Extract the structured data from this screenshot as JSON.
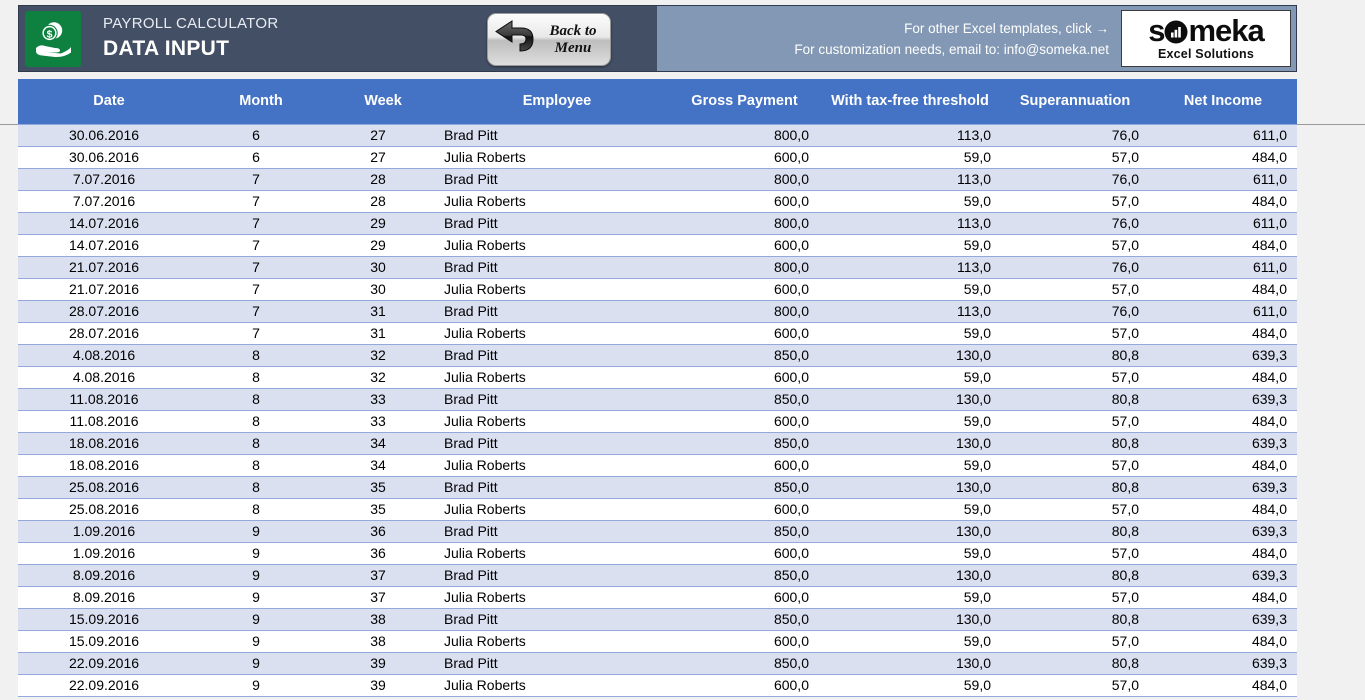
{
  "banner": {
    "logo_icon": "money-in-hand-icon",
    "subtitle": "PAYROLL CALCULATOR",
    "title": "DATA INPUT",
    "back_button": {
      "line1": "Back to",
      "line2": "Menu",
      "icon": "back-arrow-icon"
    },
    "promo_line1": "For other Excel templates, click →",
    "promo_line2": "For customization needs, email to: info@someka.net",
    "brand": {
      "word": "someka",
      "tagline": "Excel Solutions"
    },
    "colors": {
      "dark_panel": "#434f65",
      "light_panel": "#8298b4",
      "logo_green": "#0e8140",
      "table_header_blue": "#4472c4",
      "row_stripe_blue": "#dbe0f1"
    }
  },
  "table": {
    "columns": [
      "Date",
      "Month",
      "Week",
      "Employee",
      "Gross Payment",
      "With tax-free threshold",
      "Superannuation",
      "Net Income"
    ],
    "rows": [
      [
        "30.06.2016",
        "6",
        "27",
        "Brad Pitt",
        "800,0",
        "113,0",
        "76,0",
        "611,0"
      ],
      [
        "30.06.2016",
        "6",
        "27",
        "Julia Roberts",
        "600,0",
        "59,0",
        "57,0",
        "484,0"
      ],
      [
        "7.07.2016",
        "7",
        "28",
        "Brad Pitt",
        "800,0",
        "113,0",
        "76,0",
        "611,0"
      ],
      [
        "7.07.2016",
        "7",
        "28",
        "Julia Roberts",
        "600,0",
        "59,0",
        "57,0",
        "484,0"
      ],
      [
        "14.07.2016",
        "7",
        "29",
        "Brad Pitt",
        "800,0",
        "113,0",
        "76,0",
        "611,0"
      ],
      [
        "14.07.2016",
        "7",
        "29",
        "Julia Roberts",
        "600,0",
        "59,0",
        "57,0",
        "484,0"
      ],
      [
        "21.07.2016",
        "7",
        "30",
        "Brad Pitt",
        "800,0",
        "113,0",
        "76,0",
        "611,0"
      ],
      [
        "21.07.2016",
        "7",
        "30",
        "Julia Roberts",
        "600,0",
        "59,0",
        "57,0",
        "484,0"
      ],
      [
        "28.07.2016",
        "7",
        "31",
        "Brad Pitt",
        "800,0",
        "113,0",
        "76,0",
        "611,0"
      ],
      [
        "28.07.2016",
        "7",
        "31",
        "Julia Roberts",
        "600,0",
        "59,0",
        "57,0",
        "484,0"
      ],
      [
        "4.08.2016",
        "8",
        "32",
        "Brad Pitt",
        "850,0",
        "130,0",
        "80,8",
        "639,3"
      ],
      [
        "4.08.2016",
        "8",
        "32",
        "Julia Roberts",
        "600,0",
        "59,0",
        "57,0",
        "484,0"
      ],
      [
        "11.08.2016",
        "8",
        "33",
        "Brad Pitt",
        "850,0",
        "130,0",
        "80,8",
        "639,3"
      ],
      [
        "11.08.2016",
        "8",
        "33",
        "Julia Roberts",
        "600,0",
        "59,0",
        "57,0",
        "484,0"
      ],
      [
        "18.08.2016",
        "8",
        "34",
        "Brad Pitt",
        "850,0",
        "130,0",
        "80,8",
        "639,3"
      ],
      [
        "18.08.2016",
        "8",
        "34",
        "Julia Roberts",
        "600,0",
        "59,0",
        "57,0",
        "484,0"
      ],
      [
        "25.08.2016",
        "8",
        "35",
        "Brad Pitt",
        "850,0",
        "130,0",
        "80,8",
        "639,3"
      ],
      [
        "25.08.2016",
        "8",
        "35",
        "Julia Roberts",
        "600,0",
        "59,0",
        "57,0",
        "484,0"
      ],
      [
        "1.09.2016",
        "9",
        "36",
        "Brad Pitt",
        "850,0",
        "130,0",
        "80,8",
        "639,3"
      ],
      [
        "1.09.2016",
        "9",
        "36",
        "Julia Roberts",
        "600,0",
        "59,0",
        "57,0",
        "484,0"
      ],
      [
        "8.09.2016",
        "9",
        "37",
        "Brad Pitt",
        "850,0",
        "130,0",
        "80,8",
        "639,3"
      ],
      [
        "8.09.2016",
        "9",
        "37",
        "Julia Roberts",
        "600,0",
        "59,0",
        "57,0",
        "484,0"
      ],
      [
        "15.09.2016",
        "9",
        "38",
        "Brad Pitt",
        "850,0",
        "130,0",
        "80,8",
        "639,3"
      ],
      [
        "15.09.2016",
        "9",
        "38",
        "Julia Roberts",
        "600,0",
        "59,0",
        "57,0",
        "484,0"
      ],
      [
        "22.09.2016",
        "9",
        "39",
        "Brad Pitt",
        "850,0",
        "130,0",
        "80,8",
        "639,3"
      ],
      [
        "22.09.2016",
        "9",
        "39",
        "Julia Roberts",
        "600,0",
        "59,0",
        "57,0",
        "484,0"
      ]
    ]
  }
}
